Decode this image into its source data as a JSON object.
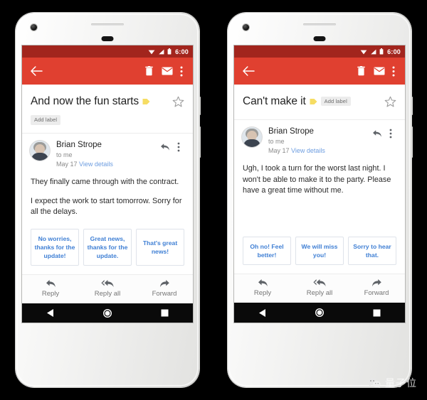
{
  "phones": [
    {
      "id": "phone-left",
      "statusbar": {
        "time": "6:00",
        "icons": [
          "wifi-icon",
          "signal-icon",
          "battery-icon"
        ]
      },
      "toolbar": {
        "back_label": "Back",
        "delete_label": "Delete",
        "mail_label": "Mark as unread",
        "overflow_label": "More options"
      },
      "subject": {
        "text": "And now the fun starts",
        "label_icon": "label-tag-icon",
        "add_label_chip": "Add label",
        "add_label_inline": false,
        "star_label": "Star"
      },
      "sender": {
        "name": "Brian Strope",
        "recipient": "to me",
        "date": "May 17",
        "view_details": "View details",
        "reply_action_label": "Reply",
        "overflow_label": "More options"
      },
      "body": [
        "They finally came through with the contract.",
        "I expect the work to start tomorrow. Sorry for all the delays."
      ],
      "smart_replies": [
        "No worries, thanks for the update!",
        "Great news, thanks for the update.",
        "That's great news!"
      ],
      "reply_bar": [
        {
          "label": "Reply",
          "icon": "reply-arrow-icon"
        },
        {
          "label": "Reply all",
          "icon": "reply-all-arrow-icon"
        },
        {
          "label": "Forward",
          "icon": "forward-arrow-icon"
        }
      ],
      "navbar": [
        {
          "name": "back",
          "icon": "triangle-back-icon"
        },
        {
          "name": "home",
          "icon": "circle-home-icon"
        },
        {
          "name": "recents",
          "icon": "square-recents-icon"
        }
      ]
    },
    {
      "id": "phone-right",
      "statusbar": {
        "time": "6:00",
        "icons": [
          "wifi-icon",
          "signal-icon",
          "battery-icon"
        ]
      },
      "toolbar": {
        "back_label": "Back",
        "delete_label": "Delete",
        "mail_label": "Mark as unread",
        "overflow_label": "More options"
      },
      "subject": {
        "text": "Can't make it",
        "label_icon": "label-tag-icon",
        "add_label_chip": "Add label",
        "add_label_inline": true,
        "star_label": "Star"
      },
      "sender": {
        "name": "Brian Strope",
        "recipient": "to me",
        "date": "May 17",
        "view_details": "View details",
        "reply_action_label": "Reply",
        "overflow_label": "More options"
      },
      "body": [
        "Ugh, I took a turn for the worst last night. I won't be able to make it to the party. Please have a great time without me."
      ],
      "smart_replies": [
        "Oh no! Feel better!",
        "We will miss you!",
        "Sorry to hear that."
      ],
      "reply_bar": [
        {
          "label": "Reply",
          "icon": "reply-arrow-icon"
        },
        {
          "label": "Reply all",
          "icon": "reply-all-arrow-icon"
        },
        {
          "label": "Forward",
          "icon": "forward-arrow-icon"
        }
      ],
      "navbar": [
        {
          "name": "back",
          "icon": "triangle-back-icon"
        },
        {
          "name": "home",
          "icon": "circle-home-icon"
        },
        {
          "name": "recents",
          "icon": "square-recents-icon"
        }
      ]
    }
  ],
  "watermark": {
    "text": "量子位",
    "icon": "wechat-icon"
  },
  "colors": {
    "statusbar_red": "#a2251d",
    "toolbar_red": "#e04030",
    "smart_reply_blue": "#3f7fd4",
    "link_blue": "#6d9de0",
    "label_yellow": "#f3d34a",
    "background": "#000000"
  }
}
